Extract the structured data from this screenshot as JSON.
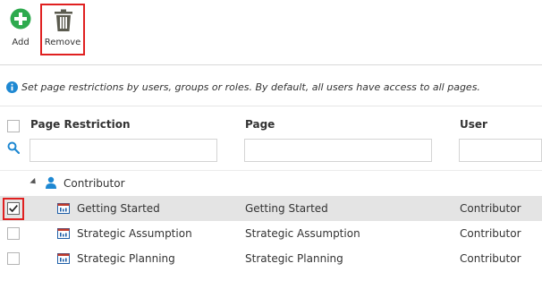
{
  "toolbar": {
    "add_label": "Add",
    "remove_label": "Remove",
    "add_icon": "plus-circle-icon",
    "remove_icon": "trash-icon",
    "add_color": "#2eaa4e",
    "remove_highlight_color": "#e02020"
  },
  "info": {
    "icon": "info-icon",
    "text": "Set page restrictions by users, groups or roles.  By default, all users have access to all pages."
  },
  "grid": {
    "columns": {
      "page_restriction": "Page Restriction",
      "page": "Page",
      "user": "User"
    },
    "filters": {
      "icon": "search-icon",
      "page_restriction": "",
      "page": "",
      "user": ""
    },
    "group": {
      "name": "Contributor",
      "icon": "person-icon",
      "expanded": true
    },
    "rows": [
      {
        "restriction": "Getting Started",
        "page": "Getting Started",
        "user": "Contributor",
        "checked": true,
        "selected": true
      },
      {
        "restriction": "Strategic Assumption",
        "page": "Strategic Assumption",
        "user": "Contributor",
        "checked": false,
        "selected": false
      },
      {
        "restriction": "Strategic Planning",
        "page": "Strategic Planning",
        "user": "Contributor",
        "checked": false,
        "selected": false
      }
    ]
  }
}
